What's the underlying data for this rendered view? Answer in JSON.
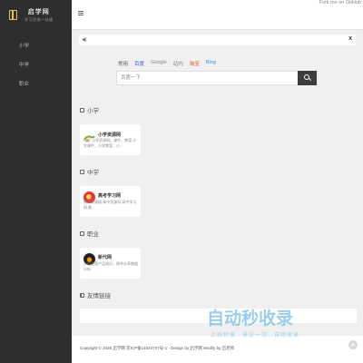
{
  "logo": {
    "title": "启学网",
    "subtitle": "学习资源一站通"
  },
  "sidebar": {
    "items": [
      {
        "label": "小学"
      },
      {
        "label": "中学"
      },
      {
        "label": "职业"
      }
    ]
  },
  "topbar": {
    "fork_label": "Fork me on GitHub"
  },
  "notice": {
    "close": "x"
  },
  "search": {
    "tabs": [
      {
        "label": "常用",
        "color": "#555555"
      },
      {
        "label": "百度",
        "color": "#3366dd"
      },
      {
        "label": "Google",
        "color": "#888888"
      },
      {
        "label": "站内",
        "color": "#888888"
      },
      {
        "label": "淘宝",
        "color": "#e5511d"
      },
      {
        "label": "Bing",
        "color": "#3a8fd6"
      }
    ],
    "placeholder": "百度一下"
  },
  "sections": [
    {
      "title": "小学",
      "card": {
        "title": "小学资源网",
        "desc": "小学 小学资源网，课件，教案,小学课件，小学教案，小..."
      }
    },
    {
      "title": "中学",
      "card": {
        "title": "高考学习网",
        "desc": "数学资源网,高中资源网,高中学习网,数..."
      }
    },
    {
      "title": "职业",
      "card": {
        "title": "新代网",
        "desc": "小店经营产品知识，探寻分享数据分析"
      }
    }
  ],
  "links": {
    "title": "友情链接"
  },
  "footer": {
    "text": "Copyright © 2025 启学网 京ICP备14024747号-1 · Design by 启学网 Modify by 启老师"
  },
  "watermark": {
    "title": "自动秒收录",
    "subtitle": "上线秒录→来访一次→自动收录"
  }
}
